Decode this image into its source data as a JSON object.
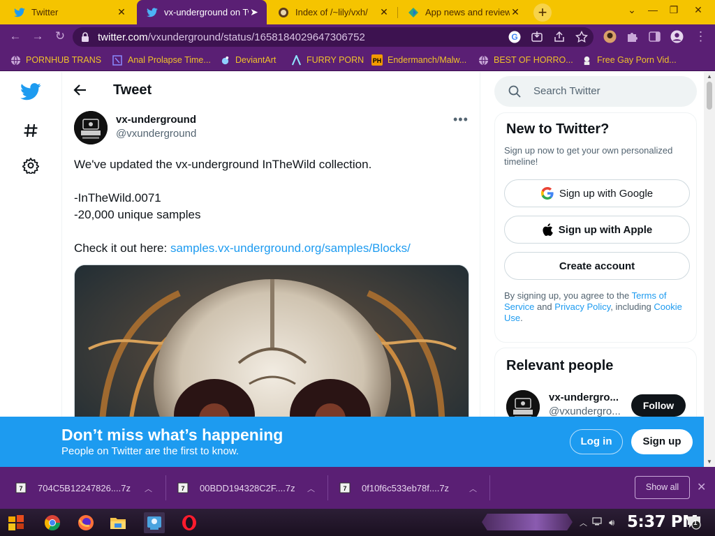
{
  "browser": {
    "tabs": [
      {
        "title": "Twitter",
        "icon": "twitter-icon",
        "active": false
      },
      {
        "title": "vx-underground on Tw",
        "icon": "twitter-icon",
        "active": true
      },
      {
        "title": "Index of /~lily/vxh/",
        "icon": "website-icon",
        "active": false
      },
      {
        "title": "App news and reviews",
        "icon": "app-store-icon",
        "active": false
      }
    ],
    "address": {
      "domain": "twitter.com",
      "path": "/vxunderground/status/1658184029647306752"
    },
    "bookmarks": [
      {
        "label": "PORNHUB TRANS",
        "icon": "globe-icon"
      },
      {
        "label": "Anal Prolapse Time...",
        "icon": "bookmark-icon"
      },
      {
        "label": "DeviantArt",
        "icon": "deviantart-icon"
      },
      {
        "label": "FURRY PORN",
        "icon": "a-logo-icon"
      },
      {
        "label": "Endermanch/Malw...",
        "icon": "ph-logo-icon"
      },
      {
        "label": "BEST OF HORRO...",
        "icon": "globe-icon"
      },
      {
        "label": "Free Gay Porn Vid...",
        "icon": "site-icon"
      }
    ]
  },
  "page": {
    "header_title": "Tweet",
    "tweet": {
      "author_name": "vx-underground",
      "author_handle": "@vxunderground",
      "line1": "We've updated the vx-underground InTheWild collection.",
      "line2": "-InTheWild.0071",
      "line3": "-20,000 unique samples",
      "line4_prefix": "Check it out here: ",
      "line4_link": "samples.vx-underground.org/samples/Blocks/"
    },
    "search_placeholder": "Search Twitter",
    "signup_card": {
      "title": "New to Twitter?",
      "subtitle": "Sign up now to get your own personalized timeline!",
      "google_label": "Sign up with Google",
      "apple_label": "Sign up with Apple",
      "create_label": "Create account",
      "legal_1": "By signing up, you agree to the ",
      "legal_terms": "Terms of Service",
      "legal_2": " and ",
      "legal_privacy": "Privacy Policy",
      "legal_3": ", including ",
      "legal_cookie": "Cookie Use",
      "legal_4": "."
    },
    "relevant_card": {
      "title": "Relevant people",
      "name": "vx-undergro...",
      "handle": "@vxundergro...",
      "follow_label": "Follow"
    },
    "banner": {
      "title": "Don’t miss what’s happening",
      "subtitle": "People on Twitter are the first to know.",
      "login_label": "Log in",
      "signup_label": "Sign up"
    }
  },
  "downloads": {
    "items": [
      {
        "name": "704C5B12247826....7z"
      },
      {
        "name": "00BDD194328C2F....7z"
      },
      {
        "name": "0f10f6c533eb78f....7z"
      }
    ],
    "show_all": "Show all"
  },
  "taskbar": {
    "clock": "5:37 PM",
    "notifications": "1"
  },
  "colors": {
    "twitter_blue": "#1d9bf0",
    "browser_purple": "#5a1f74",
    "tab_yellow": "#f5c400"
  }
}
